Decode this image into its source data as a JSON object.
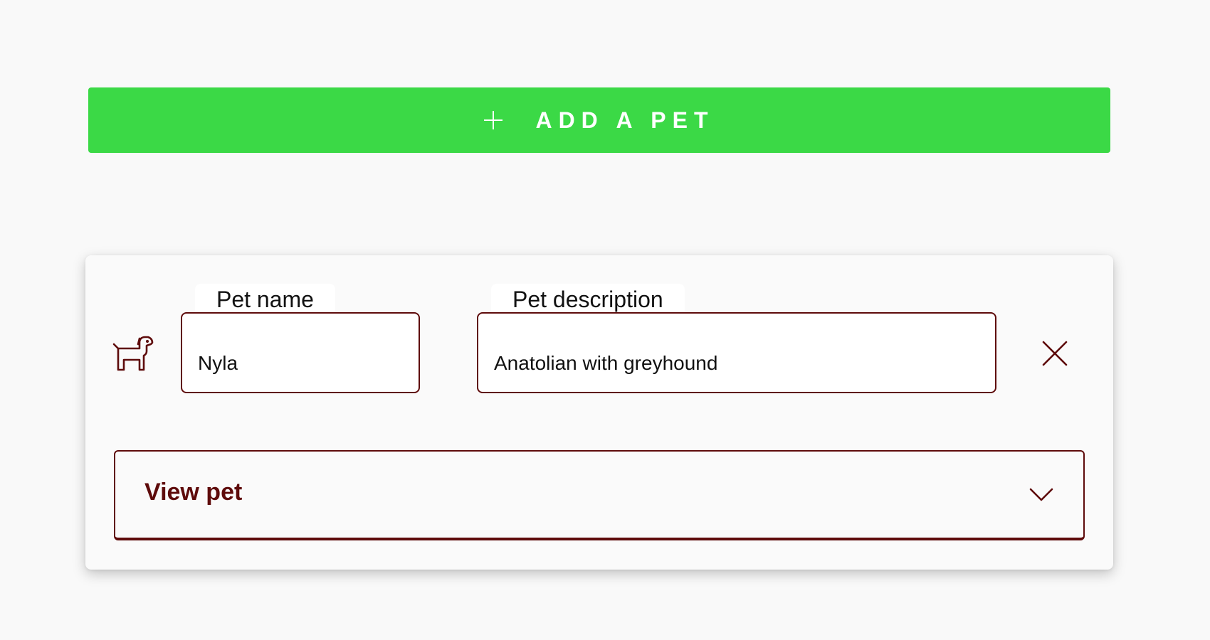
{
  "add_button": {
    "label": "ADD A PET",
    "icon": "plus-icon",
    "color": "#3bd946"
  },
  "pet_card": {
    "pet_icon": "dog-icon",
    "name_field": {
      "legend": "Pet name",
      "value": "Nyla"
    },
    "description_field": {
      "legend": "Pet description",
      "value": "Anatolian with greyhound"
    },
    "remove_icon": "close-icon",
    "view_pet": {
      "label": "View pet",
      "icon": "chevron-down-icon"
    },
    "accent_color": "#5e0b0b"
  }
}
